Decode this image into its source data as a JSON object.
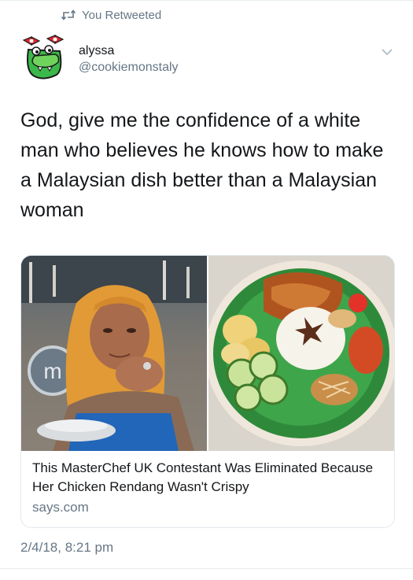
{
  "retweet": {
    "label": "You Retweeted",
    "icon": "retweet-icon"
  },
  "author": {
    "display_name": "alyssa",
    "handle": "@cookiemonstaly",
    "avatar_icon": "green-monster-avatar"
  },
  "tweet": {
    "text": "God, give me the confidence of a white man who believes he knows how to make a Malaysian dish better than a Malaysian woman",
    "timestamp": "2/4/18, 8:21 pm"
  },
  "card": {
    "title": "This MasterChef UK Contestant Was Eliminated Because Her Chicken Rendang Wasn't Crispy",
    "domain": "says.com",
    "left_image": "woman-in-headscarf-cooking-photo",
    "right_image": "nasi-lemak-plate-photo"
  },
  "menu": {
    "icon": "chevron-down-icon"
  },
  "colors": {
    "secondary_text": "#657786",
    "primary_text": "#14171a",
    "border": "#e1e8ed",
    "avatar_green": "#3bb84a",
    "avatar_bow": "#d9262b"
  }
}
